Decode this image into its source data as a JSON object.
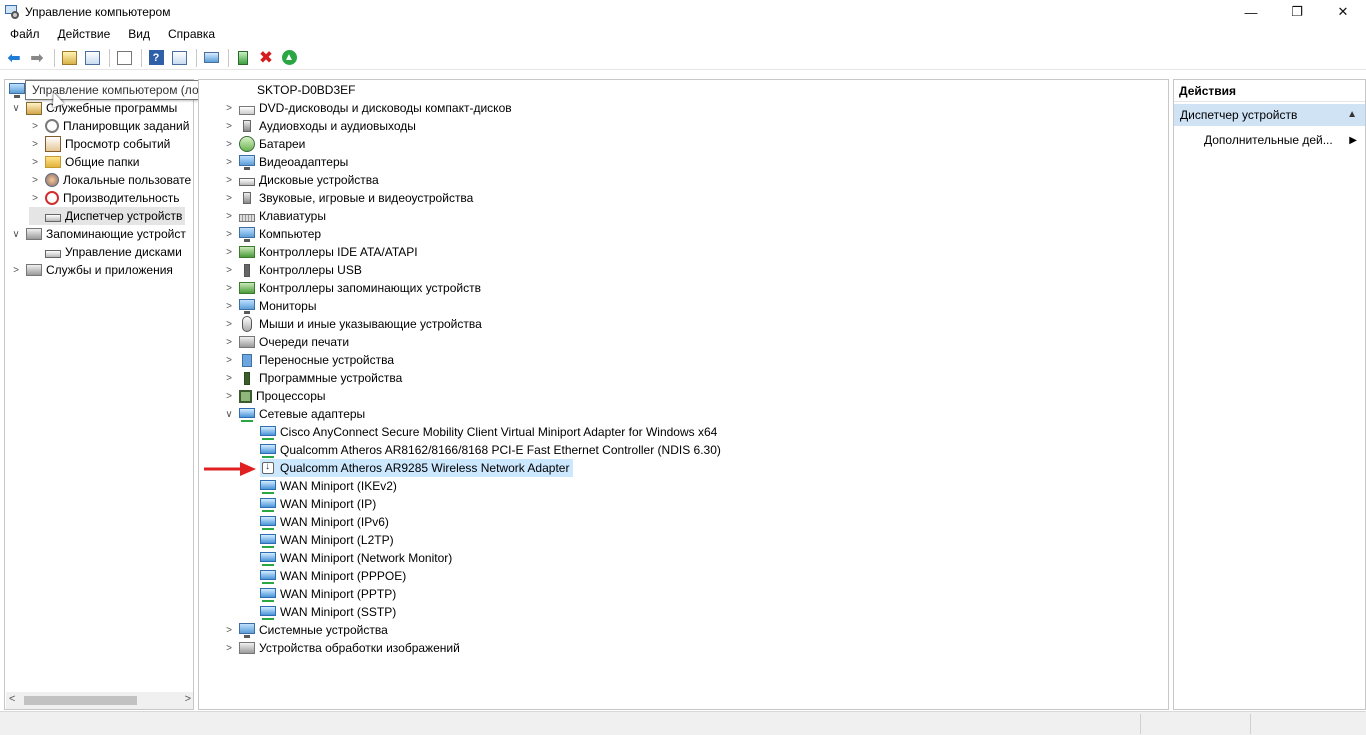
{
  "window": {
    "title": "Управление компьютером",
    "minimize": "—",
    "maximize": "❐",
    "close": "✕"
  },
  "menu": [
    "Файл",
    "Действие",
    "Вид",
    "Справка"
  ],
  "tooltip": "Управление компьютером (локальным)",
  "left_tree": [
    {
      "label": "Служебные программы",
      "expander": "∨"
    },
    {
      "label": "Планировщик заданий",
      "expander": ">"
    },
    {
      "label": "Просмотр событий",
      "expander": ">"
    },
    {
      "label": "Общие папки",
      "expander": ">"
    },
    {
      "label": "Локальные пользовате",
      "expander": ">"
    },
    {
      "label": "Производительность",
      "expander": ">"
    },
    {
      "label": "Диспетчер устройств",
      "expander": ""
    },
    {
      "label": "Запоминающие устройст",
      "expander": "∨"
    },
    {
      "label": "Управление дисками",
      "expander": ""
    },
    {
      "label": "Службы и приложения",
      "expander": ">"
    }
  ],
  "device_tree": {
    "root": "SKTOP-D0BD3EF",
    "categories": [
      "DVD-дисководы и дисководы компакт-дисков",
      "Аудиовходы и аудиовыходы",
      "Батареи",
      "Видеоадаптеры",
      "Дисковые устройства",
      "Звуковые, игровые и видеоустройства",
      "Клавиатуры",
      "Компьютер",
      "Контроллеры IDE ATA/ATAPI",
      "Контроллеры USB",
      "Контроллеры запоминающих устройств",
      "Мониторы",
      "Мыши и иные указывающие устройства",
      "Очереди печати",
      "Переносные устройства",
      "Программные устройства",
      "Процессоры",
      "Сетевые адаптеры"
    ],
    "network_adapters": [
      "Cisco AnyConnect Secure Mobility Client Virtual Miniport Adapter for Windows x64",
      "Qualcomm Atheros AR8162/8166/8168 PCI-E Fast Ethernet Controller (NDIS 6.30)",
      "Qualcomm Atheros AR9285 Wireless Network Adapter",
      "WAN Miniport (IKEv2)",
      "WAN Miniport (IP)",
      "WAN Miniport (IPv6)",
      "WAN Miniport (L2TP)",
      "WAN Miniport (Network Monitor)",
      "WAN Miniport (PPPOE)",
      "WAN Miniport (PPTP)",
      "WAN Miniport (SSTP)"
    ],
    "after": [
      "Системные устройства",
      "Устройства обработки изображений"
    ]
  },
  "actions": {
    "header": "Действия",
    "section": "Диспетчер устройств",
    "more": "Дополнительные дей..."
  }
}
